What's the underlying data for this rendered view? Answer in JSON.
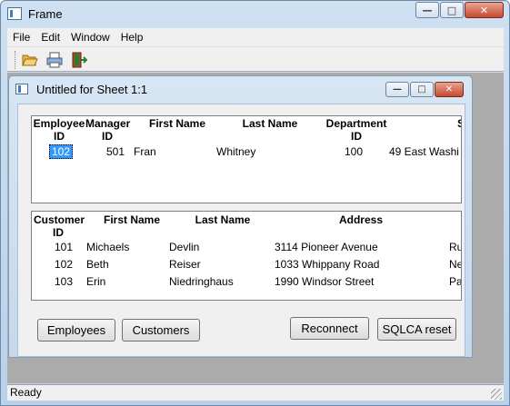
{
  "frame": {
    "title": "Frame"
  },
  "window_buttons": {
    "minimize": "—",
    "maximize": "□",
    "close": "✕"
  },
  "menu": [
    "File",
    "Edit",
    "Window",
    "Help"
  ],
  "toolbar": {
    "icons": [
      "folder-open-icon",
      "print-icon",
      "exit-door-icon"
    ]
  },
  "child": {
    "title": "Untitled for Sheet 1:1"
  },
  "employees": {
    "headers": [
      {
        "l1": "Employee",
        "l2": "ID"
      },
      {
        "l1": "Manager",
        "l2": "ID"
      },
      {
        "l1": "First Name",
        "l2": ""
      },
      {
        "l1": "Last Name",
        "l2": ""
      },
      {
        "l1": "Department",
        "l2": "ID"
      },
      {
        "l1": "S",
        "l2": ""
      }
    ],
    "row": {
      "employee_id": "102",
      "manager_id": "501",
      "first_name": "Fran",
      "last_name": "Whitney",
      "department_id": "100",
      "street": "49 East Washi"
    }
  },
  "customers": {
    "headers": [
      {
        "l1": "Customer",
        "l2": "ID"
      },
      {
        "l1": "First Name",
        "l2": ""
      },
      {
        "l1": "Last Name",
        "l2": ""
      },
      {
        "l1": "Address",
        "l2": ""
      }
    ],
    "rows": [
      {
        "id": "101",
        "first": "Michaels",
        "last": "Devlin",
        "address": "3114 Pioneer Avenue",
        "city": "Ru"
      },
      {
        "id": "102",
        "first": "Beth",
        "last": "Reiser",
        "address": "1033 Whippany Road",
        "city": "Ne"
      },
      {
        "id": "103",
        "first": "Erin",
        "last": "Niedringhaus",
        "address": "1990 Windsor Street",
        "city": "Pa"
      }
    ]
  },
  "buttons": {
    "employees": "Employees",
    "customers": "Customers",
    "reconnect": "Reconnect",
    "sqlca_reset": "SQLCA reset"
  },
  "status": {
    "text": "Ready"
  }
}
